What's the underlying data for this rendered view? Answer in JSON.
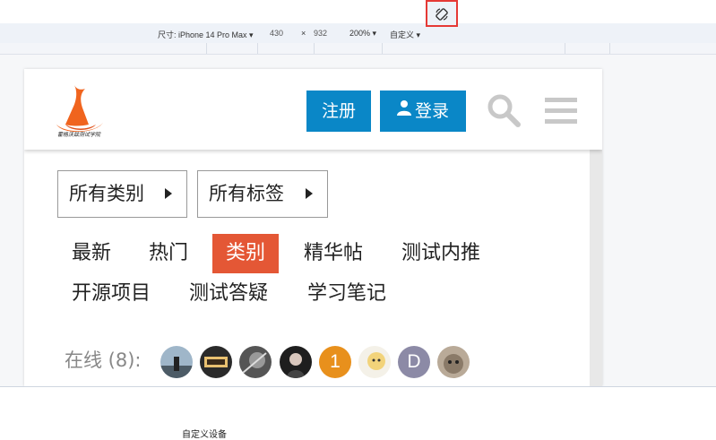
{
  "devtools": {
    "dimensions_label": "尺寸: iPhone 14 Pro Max ▾",
    "width": "430",
    "times": "×",
    "height": "932",
    "zoom": "200% ▾",
    "throttle": "自定义 ▾",
    "rotate_icon": "rotate-icon",
    "highlight_color": "#e53935",
    "bottom_label": "自定义设备"
  },
  "site": {
    "logo_text": "霍格沃兹测试学院",
    "register_label": "注册",
    "login_label": "登录",
    "button_color": "#0a87c7",
    "accent_color": "#e45735"
  },
  "filters": {
    "category": "所有类别",
    "tags": "所有标签"
  },
  "nav": {
    "items": [
      "最新",
      "热门",
      "类别",
      "精华帖",
      "测试内推",
      "开源项目",
      "测试答疑",
      "学习笔记"
    ],
    "active": "类别"
  },
  "online": {
    "label": "在线 (8):",
    "avatars": [
      {
        "type": "photo",
        "icon": "avatar-photo-seaside"
      },
      {
        "type": "photo",
        "icon": "avatar-photo-get"
      },
      {
        "type": "photo",
        "icon": "avatar-photo-sketch"
      },
      {
        "type": "photo",
        "icon": "avatar-photo-girl"
      },
      {
        "type": "letter",
        "letter": "1",
        "color": "#e8901c"
      },
      {
        "type": "photo",
        "icon": "avatar-photo-cartoon"
      },
      {
        "type": "letter",
        "letter": "D",
        "color": "#8c8aa6"
      },
      {
        "type": "photo",
        "icon": "avatar-photo-cat"
      }
    ]
  }
}
